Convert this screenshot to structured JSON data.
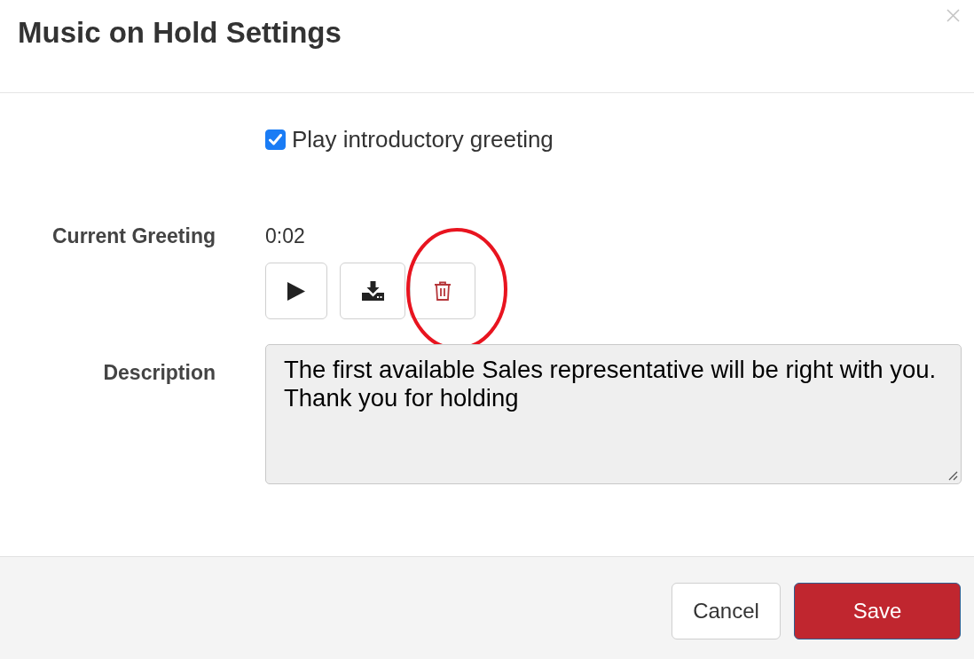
{
  "dialog": {
    "title": "Music on Hold Settings"
  },
  "greeting_option": {
    "label": "Play introductory greeting",
    "checked": true
  },
  "current_greeting": {
    "label": "Current Greeting",
    "duration": "0:02",
    "buttons": [
      {
        "kind": "play",
        "circled": false
      },
      {
        "kind": "download",
        "circled": false
      },
      {
        "kind": "delete",
        "circled": true
      }
    ]
  },
  "description": {
    "label": "Description",
    "value": "The first available Sales representative will be right with you. Thank you for holding"
  },
  "footer": {
    "buttons": [
      {
        "label": "Cancel",
        "kind": "secondary"
      },
      {
        "label": "Save",
        "kind": "primary"
      }
    ]
  }
}
